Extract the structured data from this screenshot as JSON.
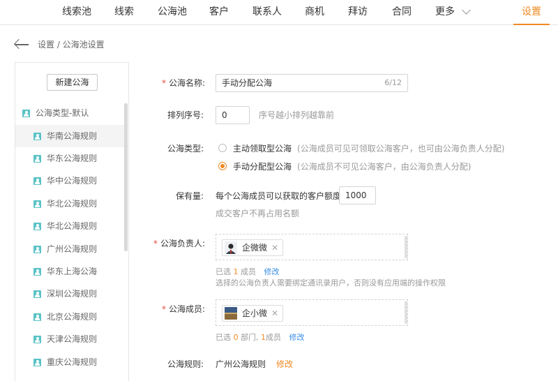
{
  "nav": {
    "items": [
      "线索池",
      "线索",
      "公海池",
      "客户",
      "联系人",
      "商机",
      "拜访",
      "合同",
      "更多"
    ],
    "settings": "设置"
  },
  "breadcrumb": "设置 / 公海池设置",
  "sidebar": {
    "new_button": "新建公海",
    "group_label": "公海类型-默认",
    "items": [
      "华南公海规则",
      "华东公海规则",
      "华中公海规则",
      "华北公海规则",
      "华北公海规则",
      "广州公海规则",
      "华东上海公海",
      "深圳公海规则",
      "北京公海规则",
      "天津公海规则",
      "重庆公海规则"
    ],
    "active_index": 0
  },
  "form": {
    "name": {
      "label": "公海名称:",
      "value": "手动分配公海",
      "counter": "6/12"
    },
    "order": {
      "label": "排列序号:",
      "value": "0",
      "hint": "序号越小排列越靠前"
    },
    "type": {
      "label": "公海类型:",
      "options": [
        {
          "label": "主动领取型公海",
          "desc": "(公海成员可见可领取公海客户，也可由公海负责人分配)",
          "selected": false
        },
        {
          "label": "手动分配型公海",
          "desc": "(公海成员不可见公海客户，由公海负责人分配)",
          "selected": true
        }
      ]
    },
    "quota": {
      "label": "保有量:",
      "prefix": "每个公海成员可以获取的客户额度",
      "value": "1000",
      "hint": "成交客户不再占用名额"
    },
    "owner": {
      "label": "公海负责人:",
      "chip": "企微微",
      "selected_prefix": "已选",
      "selected_count": "1",
      "selected_suffix": "成员",
      "modify": "修改",
      "note": "选择的公海负责人需要绑定通讯录用户，否则没有应用端的操作权限"
    },
    "members": {
      "label": "公海成员:",
      "chip": "企小微",
      "selected_prefix": "已选",
      "dept_count": "0",
      "dept_suffix": "部门,",
      "member_count": "1",
      "member_suffix": "成员",
      "modify": "修改"
    },
    "rule": {
      "label": "公海规则:",
      "value": "广州公海规则",
      "modify": "修改"
    }
  },
  "colors": {
    "accent": "#f08a24",
    "link": "#3a8ee6",
    "required": "#e74c3c",
    "icon": "#5bc3c6"
  }
}
